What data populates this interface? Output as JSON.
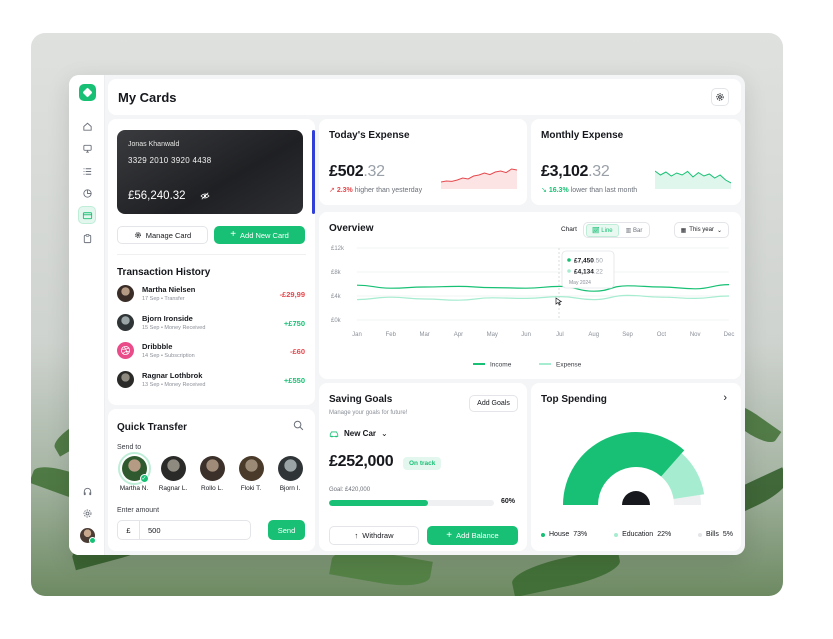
{
  "colors": {
    "accent": "#17c074",
    "danger": "#e5484d",
    "education": "#a6ecd0",
    "bills": "#eef0f2"
  },
  "header": {
    "title": "My Cards"
  },
  "card": {
    "holder": "Jonas Khanwald",
    "number": "3329 2010 3920 4438",
    "balance": "£56,240.32",
    "manage_label": "Manage Card",
    "add_label": "Add New Card"
  },
  "transactions": {
    "title": "Transaction History",
    "items": [
      {
        "name": "Martha Nielsen",
        "date": "17 Sep",
        "type": "Transfer",
        "amount": "-£29,99"
      },
      {
        "name": "Bjorn Ironside",
        "date": "15 Sep",
        "type": "Money Received",
        "amount": "+£750"
      },
      {
        "name": "Dribbble",
        "date": "14 Sep",
        "type": "Subscription",
        "amount": "-£60"
      },
      {
        "name": "Ragnar Lothbrok",
        "date": "13 Sep",
        "type": "Money Received",
        "amount": "+£550"
      }
    ]
  },
  "transfer": {
    "title": "Quick Transfer",
    "send_to": "Send to",
    "people": [
      "Martha N.",
      "Ragnar L.",
      "Rollo L.",
      "Floki T.",
      "Bjorn I."
    ],
    "enter_amount": "Enter amount",
    "currency": "£",
    "amount": "500",
    "send_label": "Send"
  },
  "today": {
    "title": "Today's Expense",
    "value_main": "£502",
    "value_dec": ".32",
    "change": "2.3%",
    "note": "higher than yesterday",
    "trend": [
      0.25,
      0.3,
      0.28,
      0.35,
      0.45,
      0.4,
      0.55,
      0.6,
      0.7,
      0.62,
      0.75,
      0.8,
      0.72,
      0.9,
      0.85
    ]
  },
  "monthly": {
    "title": "Monthly Expense",
    "value_main": "£3,102",
    "value_dec": ".32",
    "change": "16.3%",
    "note": "lower than last month",
    "trend": [
      0.8,
      0.6,
      0.75,
      0.55,
      0.7,
      0.6,
      0.78,
      0.5,
      0.72,
      0.55,
      0.65,
      0.45,
      0.6,
      0.35,
      0.2
    ]
  },
  "overview": {
    "title": "Overview",
    "chart_label": "Chart",
    "line_label": "Line",
    "bar_label": "Bar",
    "period_label": "This year",
    "tooltip": {
      "income": "£7,450",
      "income_dec": ".50",
      "expense": "£4,134",
      "expense_dec": ".22",
      "date": "May 2024"
    }
  },
  "chart_data": {
    "type": "line",
    "title": "Overview",
    "categories": [
      "Jan",
      "Feb",
      "Mar",
      "Apr",
      "May",
      "Jun",
      "Jul",
      "Aug",
      "Sep",
      "Oct",
      "Nov",
      "Dec"
    ],
    "y_ticks": [
      "£12k",
      "£8k",
      "£4k",
      "£0k"
    ],
    "ylim": [
      0,
      12000
    ],
    "series": [
      {
        "name": "Income",
        "values": [
          5800,
          5300,
          5500,
          5600,
          5400,
          5300,
          5600,
          4800,
          5700,
          5500,
          5200,
          5900
        ]
      },
      {
        "name": "Expense",
        "values": [
          3400,
          3800,
          3500,
          3300,
          3700,
          3600,
          3900,
          3400,
          4100,
          3800,
          3600,
          4000
        ]
      }
    ],
    "legend_position": "bottom"
  },
  "goals": {
    "title": "Saving Goals",
    "subtitle": "Manage your goals for future!",
    "add_label": "Add Goals",
    "goal_name": "New Car",
    "saved": "£252,000",
    "status": "On track",
    "goal_text": "Goal: £420,000",
    "percent_label": "60%",
    "progress": 0.6,
    "withdraw_label": "Withdraw",
    "add_balance_label": "Add Balance"
  },
  "spending": {
    "title": "Top Spending",
    "segments": [
      {
        "label": "House",
        "pct_label": "73%",
        "value": 73
      },
      {
        "label": "Education",
        "pct_label": "22%",
        "value": 22
      },
      {
        "label": "Bills",
        "pct_label": "5%",
        "value": 5
      }
    ]
  }
}
